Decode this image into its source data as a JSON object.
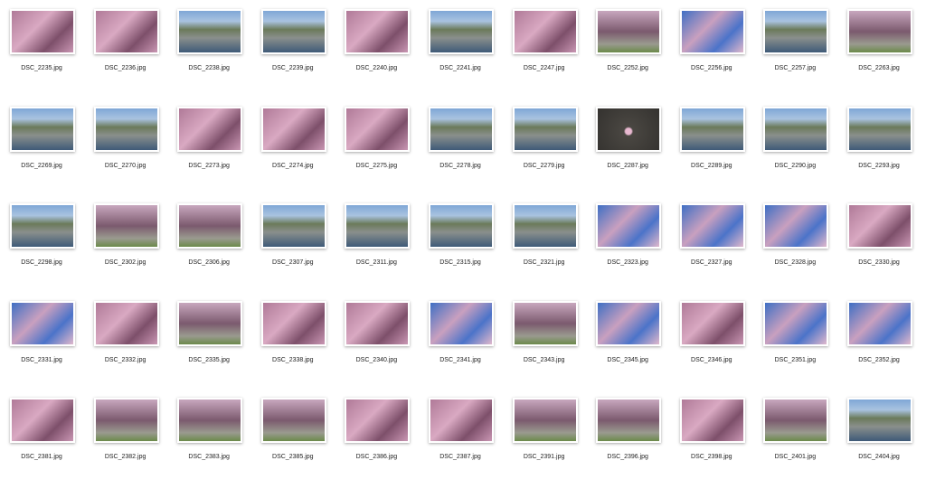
{
  "files": [
    "DSC_2235.jpg",
    "DSC_2236.jpg",
    "DSC_2238.jpg",
    "DSC_2239.jpg",
    "DSC_2240.jpg",
    "DSC_2241.jpg",
    "DSC_2247.jpg",
    "DSC_2252.jpg",
    "DSC_2256.jpg",
    "DSC_2257.jpg",
    "DSC_2263.jpg",
    "DSC_2269.jpg",
    "DSC_2270.jpg",
    "DSC_2273.jpg",
    "DSC_2274.jpg",
    "DSC_2275.jpg",
    "DSC_2278.jpg",
    "DSC_2279.jpg",
    "DSC_2287.jpg",
    "DSC_2289.jpg",
    "DSC_2290.jpg",
    "DSC_2293.jpg",
    "DSC_2298.jpg",
    "DSC_2302.jpg",
    "DSC_2306.jpg",
    "DSC_2307.jpg",
    "DSC_2311.jpg",
    "DSC_2315.jpg",
    "DSC_2321.jpg",
    "DSC_2323.jpg",
    "DSC_2327.jpg",
    "DSC_2328.jpg",
    "DSC_2330.jpg",
    "DSC_2331.jpg",
    "DSC_2332.jpg",
    "DSC_2335.jpg",
    "DSC_2338.jpg",
    "DSC_2340.jpg",
    "DSC_2341.jpg",
    "DSC_2343.jpg",
    "DSC_2345.jpg",
    "DSC_2346.jpg",
    "DSC_2351.jpg",
    "DSC_2352.jpg",
    "DSC_2381.jpg",
    "DSC_2382.jpg",
    "DSC_2383.jpg",
    "DSC_2385.jpg",
    "DSC_2386.jpg",
    "DSC_2387.jpg",
    "DSC_2391.jpg",
    "DSC_2396.jpg",
    "DSC_2398.jpg",
    "DSC_2401.jpg",
    "DSC_2404.jpg"
  ]
}
